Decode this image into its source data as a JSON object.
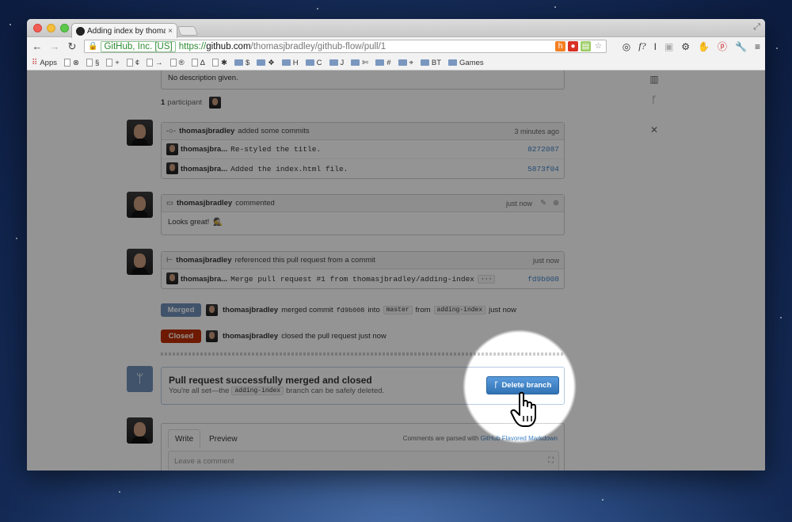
{
  "browser": {
    "tab_title": "Adding index by thomasjb",
    "tab_close": "×",
    "ev_label": "GitHub, Inc. [US]",
    "url_scheme": "https://",
    "url_host": "github.com",
    "url_path": "/thomasjbradley/github-flow/pull/1"
  },
  "bookmarks": [
    {
      "label": "Apps"
    },
    {
      "label": "⊗"
    },
    {
      "label": "§"
    },
    {
      "label": "+"
    },
    {
      "label": "¢"
    },
    {
      "label": "→"
    },
    {
      "label": "®"
    },
    {
      "label": "Δ"
    },
    {
      "label": "✱"
    },
    {
      "label": "$"
    },
    {
      "label": "❖"
    },
    {
      "label": "H"
    },
    {
      "label": "C"
    },
    {
      "label": "J"
    },
    {
      "label": "✄"
    },
    {
      "label": "#"
    },
    {
      "label": "⌖"
    },
    {
      "label": "BT"
    },
    {
      "label": "Games"
    }
  ],
  "top": {
    "no_description": "No description given.",
    "participants_count": "1",
    "participants_label": "participant"
  },
  "commits_event": {
    "author": "thomasjbradley",
    "action": "added some commits",
    "time": "3 minutes ago",
    "rows": [
      {
        "author": "thomasjbra...",
        "message": "Re-styled the title.",
        "sha": "8272087"
      },
      {
        "author": "thomasjbra...",
        "message": "Added the index.html file.",
        "sha": "5873f04"
      }
    ]
  },
  "comment_event": {
    "author": "thomasjbradley",
    "action": "commented",
    "time": "just now",
    "body": "Looks great!"
  },
  "reference_event": {
    "author": "thomasjbradley",
    "action": "referenced this pull request from a commit",
    "time": "just now",
    "row": {
      "author": "thomasjbra...",
      "message": "Merge pull request #1 from thomasjbradley/adding-index",
      "ellipsis": "···",
      "sha": "fd9b008"
    }
  },
  "merged_event": {
    "label": "Merged",
    "author": "thomasjbradley",
    "text1": "merged commit",
    "sha": "fd9b008",
    "text2": "into",
    "target": "master",
    "text3": "from",
    "source": "adding-index",
    "time": "just now"
  },
  "closed_event": {
    "label": "Closed",
    "author": "thomasjbradley",
    "text": "closed the pull request just now"
  },
  "merge_box": {
    "title": "Pull request successfully merged and closed",
    "sub_before": "You're all set—the",
    "branch": "adding-index",
    "sub_after": "branch can be safely deleted.",
    "button": "Delete branch"
  },
  "comment_form": {
    "tab_write": "Write",
    "tab_preview": "Preview",
    "note_prefix": "Comments are parsed with",
    "note_link": "GitHub Flavored Markdown",
    "placeholder": "Leave a comment"
  },
  "colors": {
    "merged": "#6e8fb8",
    "closed": "#bd2c00",
    "link": "#4183c4",
    "button": "#3e82c4"
  }
}
